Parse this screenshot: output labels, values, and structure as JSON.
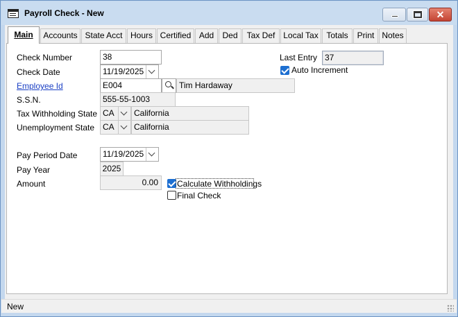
{
  "window": {
    "title": "Payroll Check - New"
  },
  "tabs": [
    {
      "label": "Main",
      "active": true
    },
    {
      "label": "Accounts"
    },
    {
      "label": "State Acct"
    },
    {
      "label": "Hours"
    },
    {
      "label": "Certified"
    },
    {
      "label": "Add"
    },
    {
      "label": "Ded"
    },
    {
      "label": "Tax Def"
    },
    {
      "label": "Local Tax"
    },
    {
      "label": "Totals"
    },
    {
      "label": "Print"
    },
    {
      "label": "Notes"
    }
  ],
  "form": {
    "check_number": {
      "label": "Check Number",
      "value": "38"
    },
    "check_date": {
      "label": "Check Date",
      "value": "11/19/2025"
    },
    "employee_id": {
      "label": "Employee Id",
      "value": "E004",
      "name": "Tim Hardaway"
    },
    "ssn": {
      "label": "S.S.N.",
      "value": "555-55-1003"
    },
    "tax_withholding_state": {
      "label": "Tax Withholding State",
      "code": "CA",
      "name": "California"
    },
    "unemployment_state": {
      "label": "Unemployment State",
      "code": "CA",
      "name": "California"
    },
    "pay_period_date": {
      "label": "Pay Period Date",
      "value": "11/19/2025"
    },
    "pay_year": {
      "label": "Pay Year",
      "value": "2025"
    },
    "amount": {
      "label": "Amount",
      "value": "0.00"
    },
    "last_entry": {
      "label": "Last Entry",
      "value": "37"
    },
    "auto_increment": {
      "label": "Auto Increment",
      "checked": true
    },
    "calculate_withholdings": {
      "label": "Calculate Withholdings",
      "checked": true
    },
    "final_check": {
      "label": "Final Check",
      "checked": false
    }
  },
  "status": {
    "text": "New"
  },
  "colors": {
    "link": "#1a3fc4",
    "checkbox_accent": "#1d6fd1",
    "title_bar": "#c9dcf0"
  }
}
